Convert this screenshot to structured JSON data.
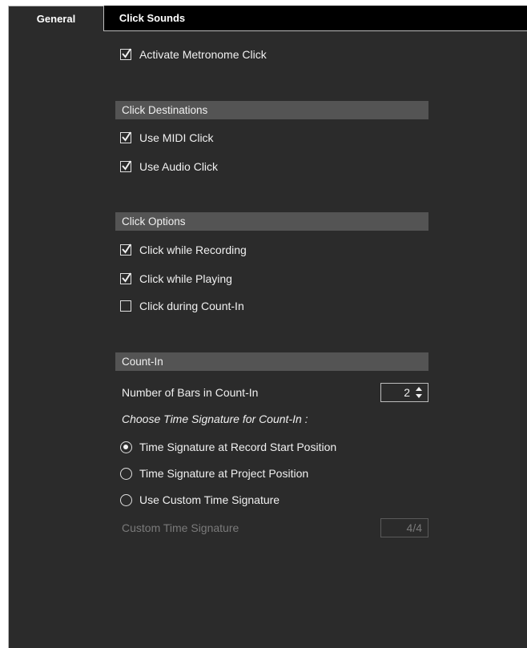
{
  "tabs": [
    {
      "label": "General",
      "active": true
    },
    {
      "label": "Click Sounds",
      "active": false
    }
  ],
  "metronome": {
    "label": "Activate Metronome Click",
    "checked": true
  },
  "destinations": {
    "header": "Click Destinations",
    "midi": {
      "label": "Use MIDI Click",
      "checked": true
    },
    "audio": {
      "label": "Use Audio Click",
      "checked": true
    }
  },
  "options": {
    "header": "Click Options",
    "recording": {
      "label": "Click while Recording",
      "checked": true
    },
    "playing": {
      "label": "Click while Playing",
      "checked": true
    },
    "countin": {
      "label": "Click during Count-In",
      "checked": false
    }
  },
  "countin": {
    "header": "Count-In",
    "bars_label": "Number of Bars in Count-In",
    "bars_value": "2",
    "choose_label": "Choose Time Signature for Count-In :",
    "radio_record": {
      "label": "Time Signature at Record Start Position",
      "selected": true
    },
    "radio_project": {
      "label": "Time Signature at Project Position",
      "selected": false
    },
    "radio_custom": {
      "label": "Use Custom Time Signature",
      "selected": false
    },
    "custom_label": "Custom Time Signature",
    "custom_value": "4/4"
  },
  "colors": {
    "panel": "#2b2b2b",
    "section": "#545454",
    "tabbar": "#000000",
    "disabled": "#7a7a7a"
  },
  "icons": {
    "checkbox": "checkmark-icon",
    "radio": "radio-dot-icon",
    "spinner": "up-down-arrows-icon"
  }
}
